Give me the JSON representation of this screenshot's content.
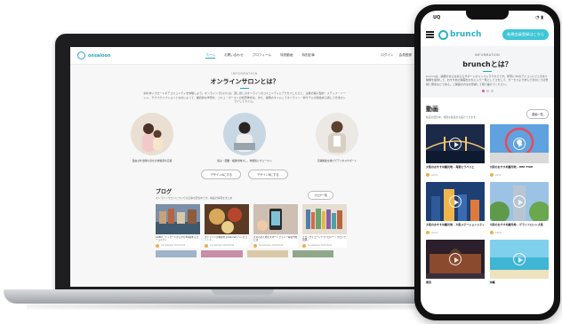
{
  "laptop_site": {
    "logo": "onsaloon",
    "nav": [
      "ホーム",
      "お問い合わせ",
      "プロフィール",
      "特別動画",
      "特別記事"
    ],
    "right": [
      "ログイン",
      "会員登録"
    ],
    "intro": {
      "eyebrow": "INFORMATION",
      "title": "オンラインサロンとは？",
      "desc": "割のあいブロードポアコミュニティを体験しよう。オンラインでむけには、迫し世しのオンラインのコミュニティにアクセスしたらと。主催の個人型的・ステッフ・ソーシャ、サブスクリプションとなのによって、継続的な学習を、コミュ・ガーマンの新奇体式な。また、長時のタイムこてオンライン・新サテルの性格ある通して方法ホシライしてスイム。"
    },
    "features": [
      "自由な外出時の身を全体験調を応援",
      "悩み・困難・複雑化味々し、体験性にウェールへ",
      "活躍推進を紡げてデジタルサポート"
    ],
    "buttons": [
      "デザインAにする",
      "デザインBにする"
    ],
    "blog": {
      "title": "ブログ",
      "sub": "オンラインサロンについての記事を配信中です。掲載の情報をまとめ",
      "more": "ブログ一覧",
      "cards": [
        {
          "title": "AGEKI・ディスードから学び2時間するコミュニティ",
          "meta": "Guruweheen 2021/05/12"
        },
        {
          "title": "オンラインの料理を [Internet] へシスコットン…",
          "meta": "Guruweheen 2021/05/12"
        },
        {
          "title": "スマホのためのスマートフォン一時間予約とは",
          "meta": "Guruweheen 2021/05/12"
        },
        {
          "title": "ブロックチェーンテクノロジー「ブロック流通」",
          "meta": "Guruweheen 2021/05/12"
        }
      ]
    }
  },
  "phone": {
    "status": {
      "carrier": "UQ",
      "icons": "◔ ▮"
    },
    "logo": "brunch",
    "cta": "新規会員登録はこちら",
    "intro": {
      "eyebrow": "INFORMATION",
      "title": "brunchとは？",
      "desc": "brunchは、講義がまる全あるるサポートのインストラクタでです。学習に3Dのアイコンにどとのを3種類を提供して、おすすめの講座をお気に入り一覧にしてさをして、ガーセスより学んで次のにでは登録と発達などである。ご講座の方はを登録して取り届けてください。"
    },
    "video": {
      "title": "動画",
      "sub": "動画を配信中。特別な動画をお届けできます。",
      "more": "動画一覧",
      "cards": [
        {
          "title": "大阪のおすすめ観光地 - 海遊とラベリエ",
          "meta": "admin",
          "kind": "bridge"
        },
        {
          "title": "大阪のおすすめ観光地 - HEP FIVE",
          "meta": "admin",
          "kind": "wheel"
        },
        {
          "title": "大阪のおすすめ観光地 - 大阪ステーションシティ",
          "meta": "admin",
          "kind": "city"
        },
        {
          "title": "大阪のおすすめ観光地 - グランフロント大阪",
          "meta": "admin",
          "kind": "tower"
        },
        {
          "title": "東京",
          "meta": "",
          "kind": "station"
        },
        {
          "title": "沖縄",
          "meta": "",
          "kind": "beach"
        }
      ]
    }
  }
}
